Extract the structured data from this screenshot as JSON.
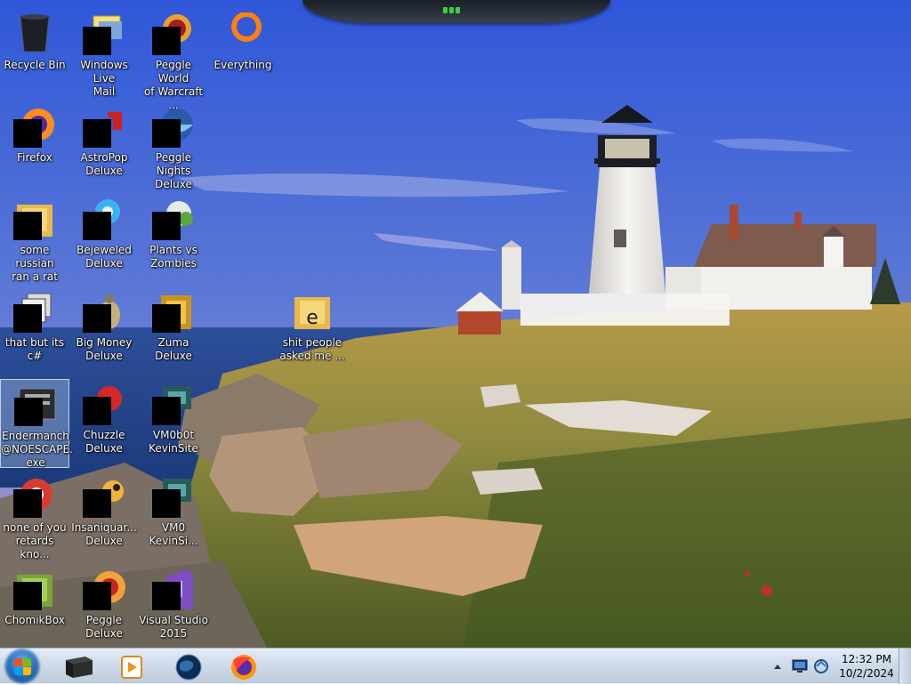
{
  "desktop": {
    "icons": [
      {
        "label_lines": [
          "Recycle Bin"
        ],
        "icon": "recycle-bin-icon"
      },
      {
        "label_lines": [
          "Windows Live",
          "Mail"
        ],
        "icon": "windows-live-mail-icon"
      },
      {
        "label_lines": [
          "Peggle World",
          "of Warcraft ..."
        ],
        "icon": "peggle-world-of-warcraft-icon"
      },
      {
        "label_lines": [
          "Everything"
        ],
        "icon": "everything-search-icon"
      },
      {
        "label_lines": [
          "Firefox"
        ],
        "icon": "firefox-icon"
      },
      {
        "label_lines": [
          "AstroPop",
          "Deluxe"
        ],
        "icon": "astropop-icon"
      },
      {
        "label_lines": [
          "Peggle Nights",
          "Deluxe"
        ],
        "icon": "peggle-nights-icon"
      },
      {
        "label_lines": [
          "some russian",
          "ran a rat"
        ],
        "icon": "folder-icon"
      },
      {
        "label_lines": [
          "Bejeweled",
          "Deluxe"
        ],
        "icon": "bejeweled-icon"
      },
      {
        "label_lines": [
          "Plants vs",
          "Zombies"
        ],
        "icon": "plants-vs-zombies-icon"
      },
      {
        "label_lines": [
          "that but its c#"
        ],
        "icon": "stacked-windows-icon"
      },
      {
        "label_lines": [
          "Big Money",
          "Deluxe"
        ],
        "icon": "big-money-icon"
      },
      {
        "label_lines": [
          "Zuma Deluxe"
        ],
        "icon": "zuma-icon"
      },
      {
        "label_lines": [
          "shit people",
          "asked me ..."
        ],
        "icon": "folder-icon"
      },
      {
        "label_lines": [
          "Endermanch",
          "@NOESCAPE.",
          "exe"
        ],
        "icon": "application-icon"
      },
      {
        "label_lines": [
          "Chuzzle",
          "Deluxe"
        ],
        "icon": "chuzzle-icon"
      },
      {
        "label_lines": [
          "VM0b0t",
          "KevinSite"
        ],
        "icon": "vm-icon"
      },
      {
        "label_lines": [
          "none of you",
          "retards kno..."
        ],
        "icon": "chrome-icon"
      },
      {
        "label_lines": [
          "Insaniquar...",
          "Deluxe"
        ],
        "icon": "insaniquarium-icon"
      },
      {
        "label_lines": [
          "VM0",
          "KevinSi..."
        ],
        "icon": "vm-icon"
      },
      {
        "label_lines": [
          "ChomikBox"
        ],
        "icon": "chomikbox-icon"
      },
      {
        "label_lines": [
          "Peggle Deluxe"
        ],
        "icon": "peggle-icon"
      },
      {
        "label_lines": [
          "Visual Studio",
          "2015"
        ],
        "icon": "visual-studio-icon"
      }
    ]
  },
  "taskbar": {
    "pinned": [
      {
        "name": "command-prompt-icon"
      },
      {
        "name": "media-player-icon"
      },
      {
        "name": "globe-icon"
      },
      {
        "name": "firefox-icon"
      }
    ],
    "clock": {
      "time": "12:32 PM",
      "date": "10/2/2024"
    }
  },
  "colors": {
    "taskbar": "#cfdbe9",
    "selection": "#bed7f5",
    "sky": "#4a6fd6"
  }
}
